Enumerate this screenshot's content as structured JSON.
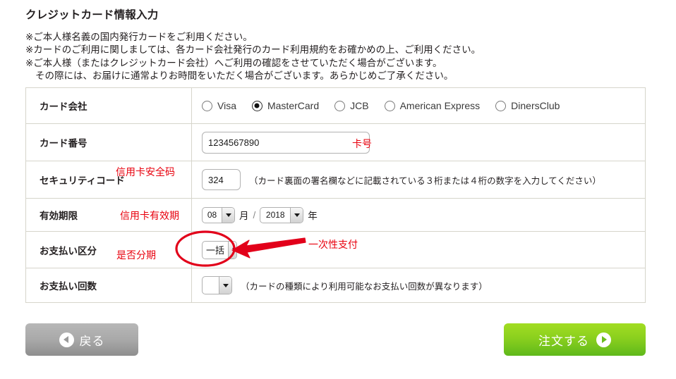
{
  "page": {
    "title": "クレジットカード情報入力",
    "notes": [
      "※ご本人様名義の国内発行カードをご利用ください。",
      "※カードのご利用に関しましては、各カード会社発行のカード利用規約をお確かめの上、ご利用ください。",
      "※ご本人様（またはクレジットカード会社）へご利用の確認をさせていただく場合がございます。",
      "その際には、お届けに通常よりお時間をいただく場合がございます。あらかじめご了承ください。"
    ]
  },
  "form": {
    "card_company": {
      "label": "カード会社",
      "options": [
        {
          "label": "Visa",
          "checked": false
        },
        {
          "label": "MasterCard",
          "checked": true
        },
        {
          "label": "JCB",
          "checked": false
        },
        {
          "label": "American Express",
          "checked": false
        },
        {
          "label": "DinersClub",
          "checked": false
        }
      ]
    },
    "card_number": {
      "label": "カード番号",
      "value": "1234567890",
      "placeholder": ""
    },
    "security_code": {
      "label": "セキュリティコード",
      "value": "324",
      "placeholder": "",
      "hint": "（カード裏面の署名欄などに記載されている３桁または４桁の数字を入力してください）"
    },
    "expiry": {
      "label": "有効期限",
      "month_value": "08",
      "month_unit": "月",
      "separator": "/",
      "year_value": "2018",
      "year_unit": "年"
    },
    "payment_type": {
      "label": "お支払い区分",
      "value": "一括"
    },
    "payment_count": {
      "label": "お支払い回数",
      "value": "",
      "hint": "（カードの種類により利用可能なお支払い回数が異なります）"
    }
  },
  "annotations": {
    "card_number": "卡号",
    "security_code": "信用卡安全码",
    "expiry": "信用卡有效期",
    "payment_type": "是否分期",
    "lump_sum": "一次性支付",
    "color": "#e8000d"
  },
  "buttons": {
    "back": {
      "label": "戻る",
      "icon": "arrow-left-circle-icon",
      "color": "#a9a9a9"
    },
    "order": {
      "label": "注文する",
      "icon": "arrow-right-circle-icon",
      "color": "#7fc91e"
    }
  }
}
